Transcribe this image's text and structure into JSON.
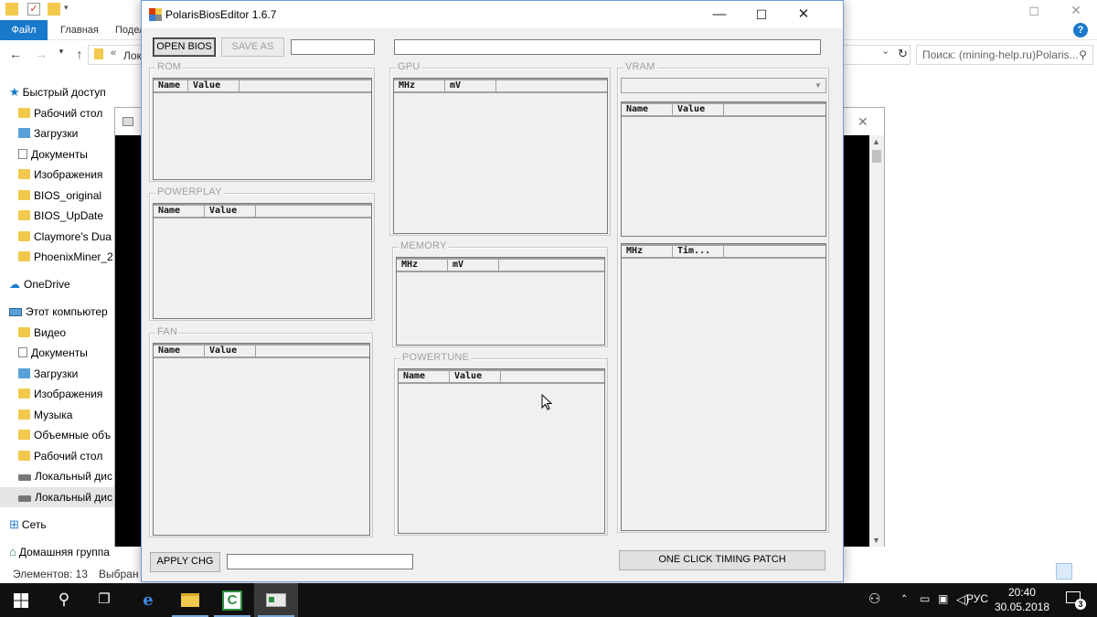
{
  "explorer": {
    "ribbon": {
      "file_tab": "Файл",
      "home_tab": "Главная",
      "share_tab": "Подел"
    },
    "address": {
      "path": "Лока"
    },
    "search": {
      "placeholder": "Поиск: (mining-help.ru)Polaris..."
    },
    "nav_items": [
      {
        "label": "Быстрый доступ",
        "icon": "star-icon"
      },
      {
        "label": "Рабочий стол",
        "icon": "folder-icon"
      },
      {
        "label": "Загрузки",
        "icon": "download-folder-icon"
      },
      {
        "label": "Документы",
        "icon": "document-icon"
      },
      {
        "label": "Изображения",
        "icon": "folder-icon"
      },
      {
        "label": "BIOS_original",
        "icon": "folder-icon"
      },
      {
        "label": "BIOS_UpDate",
        "icon": "folder-icon"
      },
      {
        "label": "Claymore's Dua",
        "icon": "folder-icon"
      },
      {
        "label": "PhoenixMiner_2",
        "icon": "folder-icon"
      },
      {
        "label": "OneDrive",
        "icon": "cloud-icon"
      },
      {
        "label": "Этот компьютер",
        "icon": "computer-icon"
      },
      {
        "label": "Видео",
        "icon": "folder-icon"
      },
      {
        "label": "Документы",
        "icon": "document-icon"
      },
      {
        "label": "Загрузки",
        "icon": "download-folder-icon"
      },
      {
        "label": "Изображения",
        "icon": "folder-icon"
      },
      {
        "label": "Музыка",
        "icon": "folder-icon"
      },
      {
        "label": "Объемные объ",
        "icon": "folder-icon"
      },
      {
        "label": "Рабочий стол",
        "icon": "folder-icon"
      },
      {
        "label": "Локальный дис",
        "icon": "drive-icon"
      },
      {
        "label": "Локальный дис",
        "icon": "drive-icon"
      },
      {
        "label": "Сеть",
        "icon": "network-icon"
      },
      {
        "label": "Домашняя группа",
        "icon": "homegroup-icon"
      }
    ],
    "status": {
      "items_count": "Элементов: 13",
      "selected": "Выбран"
    }
  },
  "pbe": {
    "title": "PolarisBiosEditor 1.6.7",
    "toolbar": {
      "open_bios": "OPEN BIOS",
      "save_as": "SAVE AS"
    },
    "groups": {
      "rom": {
        "label": "ROM",
        "columns": [
          "Name",
          "Value"
        ]
      },
      "powerplay": {
        "label": "POWERPLAY",
        "columns": [
          "Name",
          "Value"
        ]
      },
      "fan": {
        "label": "FAN",
        "columns": [
          "Name",
          "Value"
        ]
      },
      "gpu": {
        "label": "GPU",
        "columns": [
          "MHz",
          "mV"
        ]
      },
      "memory": {
        "label": "MEMORY",
        "columns": [
          "MHz",
          "mV"
        ]
      },
      "powertune": {
        "label": "POWERTUNE",
        "columns": [
          "Name",
          "Value"
        ]
      },
      "vram": {
        "label": "VRAM",
        "columns": [
          "Name",
          "Value"
        ],
        "timing_columns": [
          "MHz",
          "Tim..."
        ]
      }
    },
    "bottom": {
      "apply_chg": "APPLY CHG",
      "timing_patch": "ONE CLICK TIMING PATCH"
    }
  },
  "taskbar": {
    "tray_lang": "РУС",
    "time": "20:40",
    "date": "30.05.2018",
    "notifications": "3"
  }
}
